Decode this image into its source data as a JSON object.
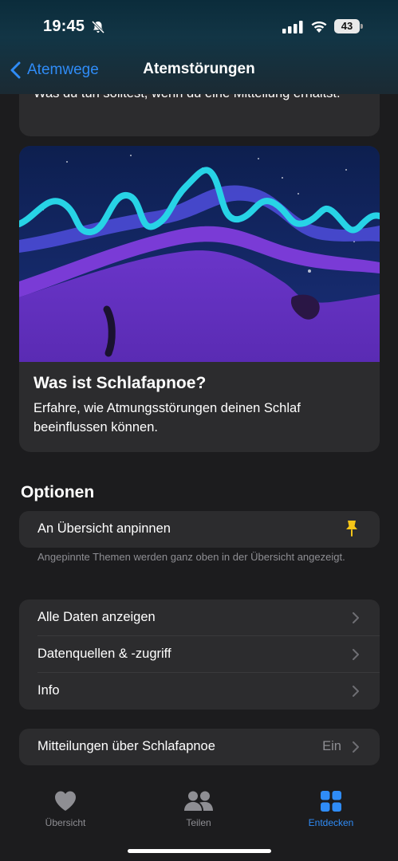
{
  "status": {
    "time": "19:45",
    "battery": "43"
  },
  "nav": {
    "back_label": "Atemwege",
    "title": "Atemstörungen"
  },
  "top_card": {
    "text": "Was du tun solltest, wenn du eine Mitteilung erhältst."
  },
  "article": {
    "title": "Was ist Schlafapnoe?",
    "subtitle": "Erfahre, wie Atmungsstörungen deinen Schlaf beeinflussen können."
  },
  "options": {
    "title": "Optionen",
    "pin_label": "An Übersicht anpinnen",
    "pin_footnote": "Angepinnte Themen werden ganz oben in der Übersicht angezeigt.",
    "rows": [
      {
        "label": "Alle Daten anzeigen"
      },
      {
        "label": "Datenquellen & -zugriff"
      },
      {
        "label": "Info"
      }
    ],
    "notifications": {
      "label": "Mitteilungen über Schlafapnoe",
      "value": "Ein"
    }
  },
  "tabs": [
    {
      "label": "Übersicht",
      "icon": "heart-icon"
    },
    {
      "label": "Teilen",
      "icon": "people-icon"
    },
    {
      "label": "Entdecken",
      "icon": "grid-icon",
      "active": true
    }
  ],
  "colors": {
    "accent": "#2f8cf7",
    "background": "#1c1c1e",
    "card": "#2c2c2e",
    "pin": "#f5c518"
  }
}
